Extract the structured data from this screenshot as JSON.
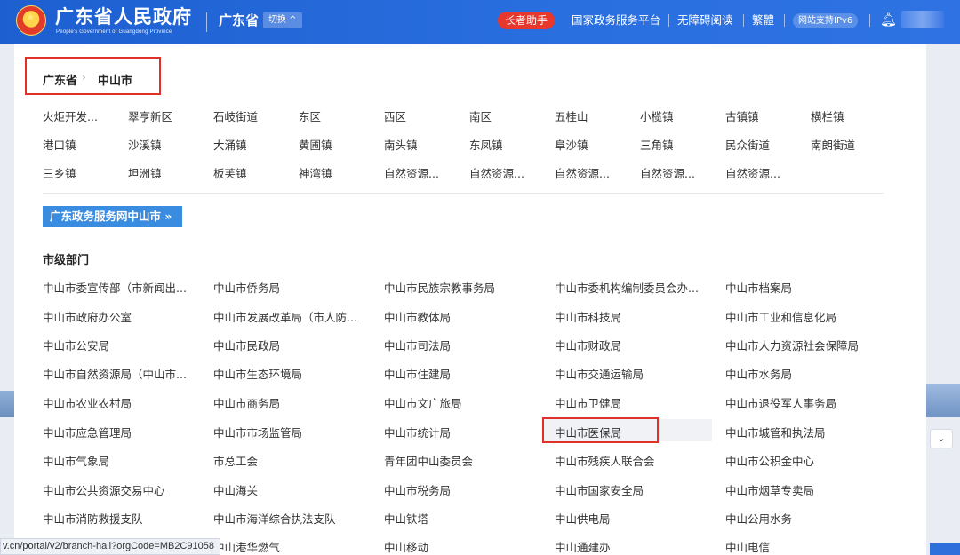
{
  "header": {
    "site_title": "广东省人民政府",
    "site_subtitle": "People's Government of Guangdong Province",
    "province": "广东省",
    "switch_label": "切换 ^",
    "elder_helper": "长者助手",
    "links": [
      "国家政务服务平台",
      "无障碍阅读",
      "繁體"
    ],
    "ipv6_badge": "网站支持IPv6"
  },
  "breadcrumb": {
    "province": "广东省",
    "separator": "›",
    "city": "中山市"
  },
  "towns": [
    [
      "火炬开发...",
      "翠亨新区",
      "石岐街道",
      "东区",
      "西区",
      "南区",
      "五桂山",
      "小榄镇",
      "古镇镇",
      "横栏镇"
    ],
    [
      "港口镇",
      "沙溪镇",
      "大涌镇",
      "黄圃镇",
      "南头镇",
      "东凤镇",
      "阜沙镇",
      "三角镇",
      "民众街道",
      "南朗街道"
    ],
    [
      "三乡镇",
      "坦洲镇",
      "板芙镇",
      "神湾镇",
      "自然资源...",
      "自然资源...",
      "自然资源...",
      "自然资源...",
      "自然资源..."
    ]
  ],
  "portal_button": "广东政务服务网中山市 »",
  "departments_title": "市级部门",
  "departments": [
    [
      "中山市委宣传部（市新闻出...",
      "中山市侨务局",
      "中山市民族宗教事务局",
      "中山市委机构编制委员会办...",
      "中山市档案局"
    ],
    [
      "中山市政府办公室",
      "中山市发展改革局（市人防...",
      "中山市教体局",
      "中山市科技局",
      "中山市工业和信息化局"
    ],
    [
      "中山市公安局",
      "中山市民政局",
      "中山市司法局",
      "中山市财政局",
      "中山市人力资源社会保障局"
    ],
    [
      "中山市自然资源局（中山市...",
      "中山市生态环境局",
      "中山市住建局",
      "中山市交通运输局",
      "中山市水务局"
    ],
    [
      "中山市农业农村局",
      "中山市商务局",
      "中山市文广旅局",
      "中山市卫健局",
      "中山市退役军人事务局"
    ],
    [
      "中山市应急管理局",
      "中山市市场监管局",
      "中山市统计局",
      "中山市医保局",
      "中山市城管和执法局"
    ],
    [
      "中山市气象局",
      "市总工会",
      "青年团中山委员会",
      "中山市残疾人联合会",
      "中山市公积金中心"
    ],
    [
      "中山市公共资源交易中心",
      "中山海关",
      "中山市税务局",
      "中山市国家安全局",
      "中山市烟草专卖局"
    ],
    [
      "中山市消防救援支队",
      "中山市海洋综合执法支队",
      "中山铁塔",
      "中山供电局",
      "中山公用水务"
    ],
    [
      "中山港华燃气",
      "中山港华燃气",
      "中山移动",
      "中山通建办",
      "中山电信"
    ]
  ],
  "status_url": "v.cn/portal/v2/branch-hall?orgCode=MB2C91058",
  "colors": {
    "header_blue": "#2a6fe0",
    "highlight_red": "#e0302a",
    "portal_button": "#3a8ce0",
    "elder_red": "#e8372c"
  }
}
